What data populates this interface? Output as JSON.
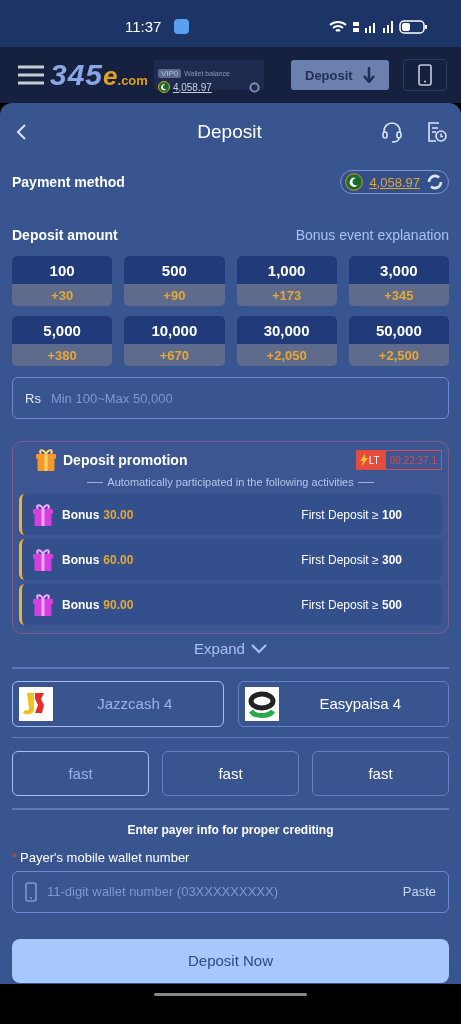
{
  "status_bar": {
    "time": "11:37"
  },
  "header": {
    "logo": {
      "digits": "345",
      "letter": "e",
      "suffix": ".com"
    },
    "wallet": {
      "tier": "VIP0",
      "label": "Wallet balance",
      "balance": "4,058.97"
    },
    "deposit_button": "Deposit"
  },
  "page": {
    "title": "Deposit"
  },
  "payment_method": {
    "label": "Payment method",
    "balance": "4,058.97"
  },
  "deposit_amount": {
    "label": "Deposit amount",
    "link": "Bonus event explanation",
    "amounts": [
      {
        "amount": "100",
        "bonus": "+30",
        "selected": false
      },
      {
        "amount": "500",
        "bonus": "+90",
        "selected": false
      },
      {
        "amount": "1,000",
        "bonus": "+173",
        "selected": false
      },
      {
        "amount": "3,000",
        "bonus": "+345",
        "selected": false
      },
      {
        "amount": "5,000",
        "bonus": "+380",
        "selected": false
      },
      {
        "amount": "10,000",
        "bonus": "+670",
        "selected": false
      },
      {
        "amount": "30,000",
        "bonus": "+2,050",
        "selected": false
      },
      {
        "amount": "50,000",
        "bonus": "+2,500",
        "selected": false
      }
    ],
    "field": {
      "prefix": "Rs",
      "placeholder": "Min 100~Max 50,000"
    }
  },
  "promotion": {
    "title": "Deposit promotion",
    "badge": "LT",
    "timer": "00:22:37.1",
    "subtitle": "Automatically participated in the following activities",
    "rows": [
      {
        "label": "Bonus",
        "amount": "30.00",
        "condition": "First Deposit ≥ **100**"
      },
      {
        "label": "Bonus",
        "amount": "60.00",
        "condition": "First Deposit ≥ **300**"
      },
      {
        "label": "Bonus",
        "amount": "90.00",
        "condition": "First Deposit ≥ **500**"
      }
    ],
    "expand": "Expand"
  },
  "channels": [
    {
      "name": "Jazzcash 4",
      "kind": "jazzcash",
      "selected": true
    },
    {
      "name": "Easypaisa 4",
      "kind": "easypaisa",
      "selected": false
    }
  ],
  "speeds": [
    {
      "label": "fast",
      "selected": true
    },
    {
      "label": "fast",
      "selected": false
    },
    {
      "label": "fast",
      "selected": false
    }
  ],
  "payer": {
    "hint": "Enter payer info for proper crediting",
    "label": "Payer's mobile wallet number",
    "required": true,
    "required_mark": "*",
    "placeholder": "11-digit wallet number (03XXXXXXXXX)",
    "paste": "Paste"
  },
  "submit": "Deposit Now"
}
